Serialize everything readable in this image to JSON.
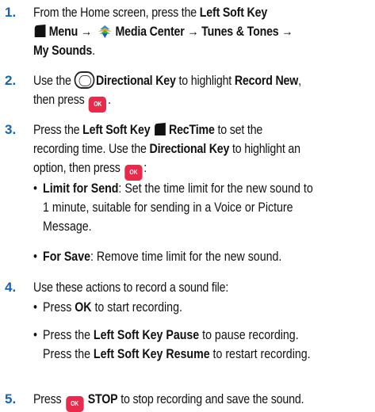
{
  "steps": [
    {
      "num": "1.",
      "t1": "From the Home screen, press the ",
      "b1": "Left Soft Key",
      "b2": "Menu",
      "arrow": "→",
      "b3": "Media Center",
      "b4": "Tunes & Tones",
      "b5": "My Sounds",
      "t_end": "."
    },
    {
      "num": "2.",
      "t1": "Use the ",
      "b1": "Directional Key",
      "t2": " to highlight ",
      "b2": "Record New",
      "t3": ",",
      "t4": "then press ",
      "t5": "."
    },
    {
      "num": "3.",
      "t1": "Press the ",
      "b1": "Left Soft Key",
      "b2": "RecTime",
      "t2": " to set the",
      "t3": "recording time. Use the ",
      "b3": "Directional Key",
      "t4": " to highlight an",
      "t5": "option, then press ",
      "t6": ":"
    },
    {
      "num": "4.",
      "t1": "Use these actions to record a sound file:"
    },
    {
      "num": "5.",
      "t1": "Press ",
      "b1": "STOP",
      "t2": " to stop recording and save the sound."
    }
  ],
  "bullets3": [
    {
      "b": "Limit for Send",
      "t": ": Set the time limit for the new sound to",
      "l2": "1 minute, suitable for sending in a Voice or Picture",
      "l3": "Message."
    },
    {
      "b": "For Save",
      "t": ": Remove time limit for the new sound."
    }
  ],
  "bullets4": [
    {
      "t1": "Press ",
      "b1": "OK",
      "t2": " to start recording."
    },
    {
      "t1": "Press the ",
      "b1": "Left Soft Key Pause",
      "t2": " to pause recording.",
      "l2a": "Press the ",
      "l2b": "Left Soft Key Resume",
      "l2c": " to restart recording."
    }
  ],
  "ok_key_label": "OK",
  "icons": {
    "soft_key": "left-soft-key-icon",
    "media_center": "media-center-icon",
    "directional": "directional-key-icon",
    "ok": "ok-key-icon"
  },
  "colors": {
    "step_number": "#1a62a8",
    "ok_key": "#e62b4c"
  }
}
